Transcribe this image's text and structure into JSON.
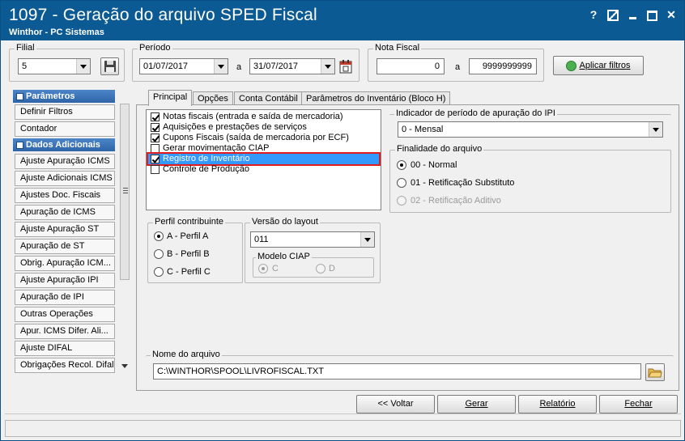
{
  "window": {
    "title": "1097 - Geração do arquivo SPED Fiscal",
    "subtitle": "Winthor - PC Sistemas",
    "help_label": "?",
    "close_label": "✕"
  },
  "filters": {
    "filial_label": "Filial",
    "filial_value": "5",
    "periodo_label": "Período",
    "date_from": "01/07/2017",
    "a_label": "a",
    "date_to": "31/07/2017",
    "nota_label": "Nota Fiscal",
    "nota_from": "0",
    "nota_to": "9999999999",
    "apply_button": "Aplicar filtros"
  },
  "sidebar": {
    "header1": "Parâmetros",
    "group1": [
      "Definir Filtros",
      "Contador"
    ],
    "header2": "Dados Adicionais",
    "group2": [
      "Ajuste Apuração ICMS",
      "Ajuste Adicionais ICMS",
      "Ajustes Doc. Fiscais",
      "Apuração de ICMS",
      "Ajuste Apuração ST",
      "Apuração de ST",
      "Obrig. Apuração ICM...",
      "Ajuste Apuração IPI",
      "Apuração de IPI",
      "Outras Operações",
      "Apur. ICMS Difer. Ali...",
      "Ajuste DIFAL",
      "Obrigações Recol. Difal"
    ]
  },
  "tabs": [
    "Principal",
    "Opções",
    "Conta Contábil",
    "Parâmetros do Inventário (Bloco H)"
  ],
  "checklist": [
    {
      "label": "Notas fiscais (entrada e saída de mercadoria)",
      "checked": true
    },
    {
      "label": "Aquisições e prestações de serviços",
      "checked": true
    },
    {
      "label": "Cupons Fiscais (saída de mercadoria por ECF)",
      "checked": true
    },
    {
      "label": "Gerar movimentação CIAP",
      "checked": false
    },
    {
      "label": "Registro de Inventário",
      "checked": true
    },
    {
      "label": "Controle de Produção",
      "checked": false
    }
  ],
  "ipi": {
    "label": "Indicador de período de apuração do IPI",
    "value": "0 - Mensal"
  },
  "finalidade": {
    "label": "Finalidade do arquivo",
    "options": [
      "00 - Normal",
      "01 - Retificação Substituto",
      "02 - Retificação Aditivo"
    ],
    "selected": 0
  },
  "perfil": {
    "label": "Perfil contribuinte",
    "options": [
      "A - Perfil A",
      "B - Perfil B",
      "C - Perfil C"
    ],
    "selected": 0
  },
  "layout": {
    "label": "Versão do layout",
    "value": "011",
    "ciap_label": "Modelo CIAP",
    "ciap_options": [
      "C",
      "D"
    ]
  },
  "arquivo": {
    "label": "Nome do arquivo",
    "value": "C:\\WINTHOR\\SPOOL\\LIVROFISCAL.TXT"
  },
  "buttons": {
    "voltar": "<< Voltar",
    "gerar": "Gerar",
    "relatorio": "Relatório",
    "fechar": "Fechar"
  }
}
